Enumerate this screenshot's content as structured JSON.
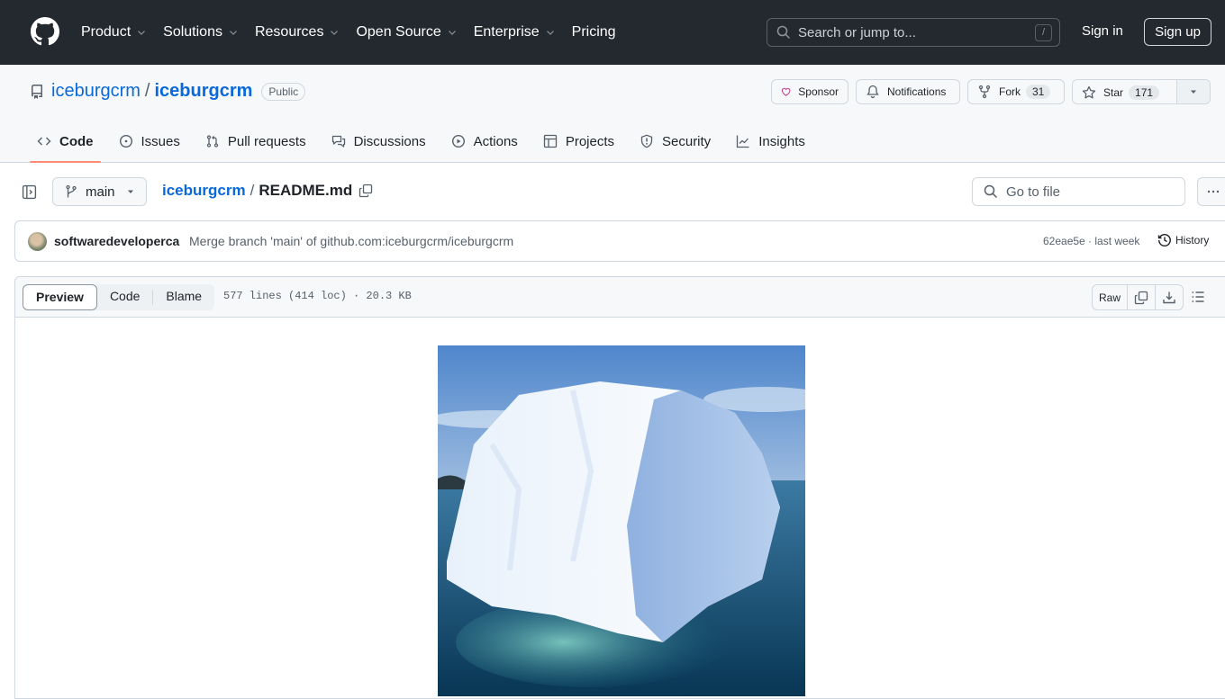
{
  "header": {
    "nav": [
      {
        "label": "Product",
        "has_menu": true
      },
      {
        "label": "Solutions",
        "has_menu": true
      },
      {
        "label": "Resources",
        "has_menu": true
      },
      {
        "label": "Open Source",
        "has_menu": true
      },
      {
        "label": "Enterprise",
        "has_menu": true
      },
      {
        "label": "Pricing",
        "has_menu": false
      }
    ],
    "search_placeholder": "Search or jump to...",
    "search_shortcut": "/",
    "sign_in": "Sign in",
    "sign_up": "Sign up"
  },
  "repo": {
    "owner": "iceburgcrm",
    "separator": "/",
    "name": "iceburgcrm",
    "visibility": "Public",
    "actions": {
      "sponsor": "Sponsor",
      "notifications": "Notifications",
      "fork": "Fork",
      "fork_count": "31",
      "star": "Star",
      "star_count": "171"
    },
    "tabs": [
      {
        "label": "Code",
        "icon": "code-icon",
        "active": true
      },
      {
        "label": "Issues",
        "icon": "issue-icon",
        "active": false
      },
      {
        "label": "Pull requests",
        "icon": "pull-request-icon",
        "active": false
      },
      {
        "label": "Discussions",
        "icon": "discussions-icon",
        "active": false
      },
      {
        "label": "Actions",
        "icon": "play-icon",
        "active": false
      },
      {
        "label": "Projects",
        "icon": "table-icon",
        "active": false
      },
      {
        "label": "Security",
        "icon": "shield-icon",
        "active": false
      },
      {
        "label": "Insights",
        "icon": "graph-icon",
        "active": false
      }
    ]
  },
  "file": {
    "branch": "main",
    "crumb_repo": "iceburgcrm",
    "crumb_sep": "/",
    "file_name": "README.md",
    "go_to_file_placeholder": "Go to file",
    "commit": {
      "author": "softwaredeveloperca",
      "message": "Merge branch 'main' of github.com:iceburgcrm/iceburgcrm",
      "meta": "62eae5e · last week",
      "history": "History"
    },
    "view_modes": [
      "Preview",
      "Code",
      "Blame"
    ],
    "active_view": "Preview",
    "info": "577 lines (414 loc) · 20.3 KB",
    "raw": "Raw"
  },
  "readme": {
    "image_alt": "Iceberg floating in deep blue ocean water"
  },
  "colors": {
    "header_bg": "#24292f",
    "link": "#0969da",
    "active_tab_underline": "#fd8c73",
    "sponsor_heart": "#bf3989"
  }
}
